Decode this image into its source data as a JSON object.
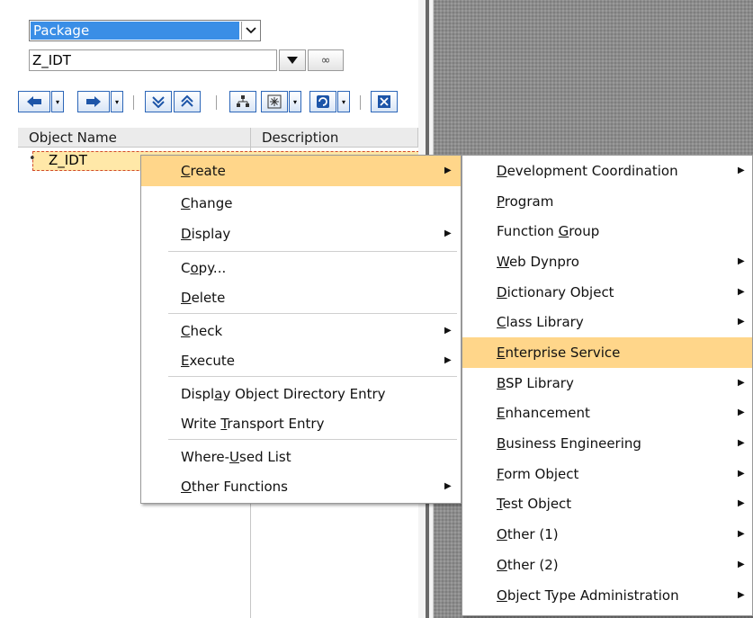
{
  "left_panel": {
    "select": {
      "value": "Package"
    },
    "text_field": {
      "value": "Z_IDT"
    },
    "columns": [
      "Object Name",
      "Description"
    ],
    "tree": {
      "node_label": "Z_IDT"
    }
  },
  "context_menu": {
    "items": [
      {
        "label": "Create",
        "submenu": true,
        "highlighted": true
      },
      {
        "label": "Change",
        "submenu": false
      },
      {
        "label": "Display",
        "submenu": true
      },
      {
        "label": "Copy...",
        "submenu": false
      },
      {
        "label": "Delete",
        "submenu": false
      },
      {
        "label": "Check",
        "submenu": true
      },
      {
        "label": "Execute",
        "submenu": true
      },
      {
        "label": "Display Object Directory Entry",
        "submenu": false
      },
      {
        "label": "Write Transport Entry",
        "submenu": false
      },
      {
        "label": "Where-Used List",
        "submenu": false
      },
      {
        "label": "Other Functions",
        "submenu": true
      }
    ]
  },
  "submenu": {
    "items": [
      {
        "label": "Development Coordination",
        "submenu": true
      },
      {
        "label": "Program",
        "submenu": false
      },
      {
        "label": "Function Group",
        "submenu": false
      },
      {
        "label": "Web Dynpro",
        "submenu": true
      },
      {
        "label": "Dictionary Object",
        "submenu": true
      },
      {
        "label": "Class Library",
        "submenu": true
      },
      {
        "label": "Enterprise Service",
        "submenu": false,
        "highlighted": true
      },
      {
        "label": "BSP Library",
        "submenu": true
      },
      {
        "label": "Enhancement",
        "submenu": true
      },
      {
        "label": "Business Engineering",
        "submenu": true
      },
      {
        "label": "Form Object",
        "submenu": true
      },
      {
        "label": "Test Object",
        "submenu": true
      },
      {
        "label": "Other (1)",
        "submenu": true
      },
      {
        "label": "Other (2)",
        "submenu": true
      },
      {
        "label": "Object Type Administration",
        "submenu": true
      }
    ]
  },
  "colors": {
    "highlight": "#ffd68a",
    "select_bg": "#3a8ee6",
    "toolbar_border": "#2c66b8"
  }
}
